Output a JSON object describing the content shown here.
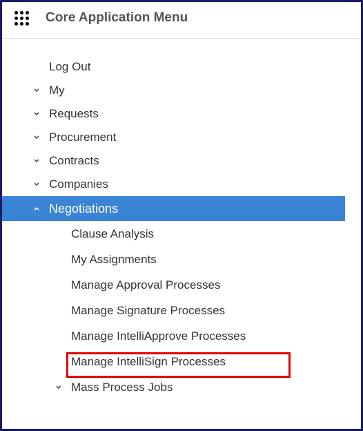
{
  "header": {
    "title": "Core Application Menu"
  },
  "menu": {
    "logout": "Log Out",
    "my": "My",
    "requests": "Requests",
    "procurement": "Procurement",
    "contracts": "Contracts",
    "companies": "Companies",
    "negotiations": "Negotiations"
  },
  "submenu": {
    "clauseAnalysis": "Clause Analysis",
    "myAssignments": "My Assignments",
    "manageApproval": "Manage Approval Processes",
    "manageSignature": "Manage Signature Processes",
    "manageIntelliApprove": "Manage IntelliApprove Processes",
    "manageIntelliSign": "Manage IntelliSign Processes",
    "massProcessJobs": "Mass Process Jobs"
  }
}
